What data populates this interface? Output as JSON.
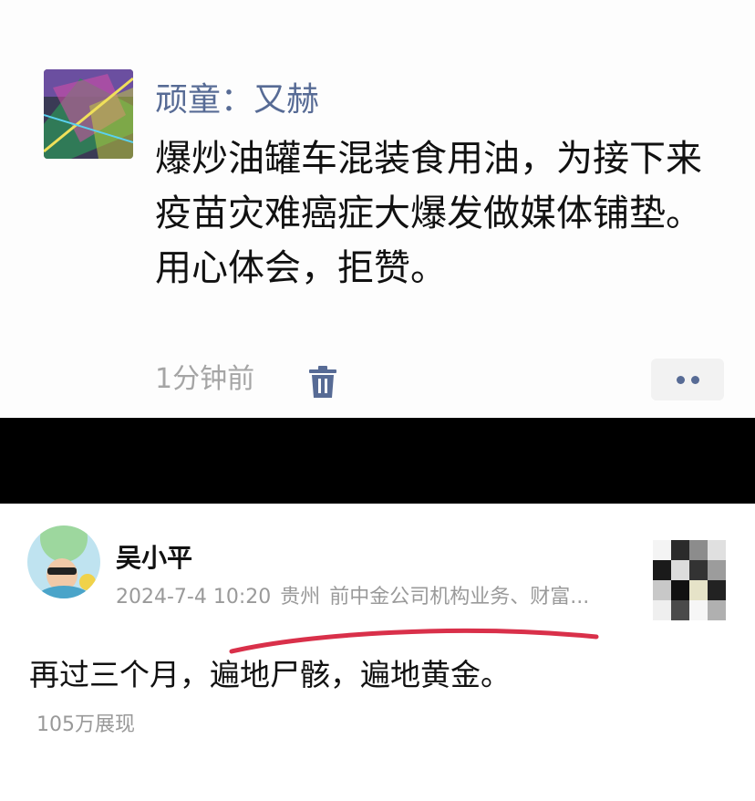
{
  "post1": {
    "author": "顽童：又赫",
    "body_lines": [
      "爆炒油罐车混装食用油，为接下来疫苗灾难癌症大爆发做媒体铺垫。",
      "用心体会，拒赞。"
    ],
    "time": "1分钟前",
    "delete_icon": "trash-icon",
    "more_icon": "more-dots-icon"
  },
  "post2": {
    "author": "吴小平",
    "date": "2024-7-4 10:20",
    "location": "贵州",
    "bio": "前中金公司机构业务、财富...",
    "body": "再过三个月，遍地尸骸，遍地黄金。",
    "views": "105万展现",
    "annotation_color": "#d9304a"
  }
}
